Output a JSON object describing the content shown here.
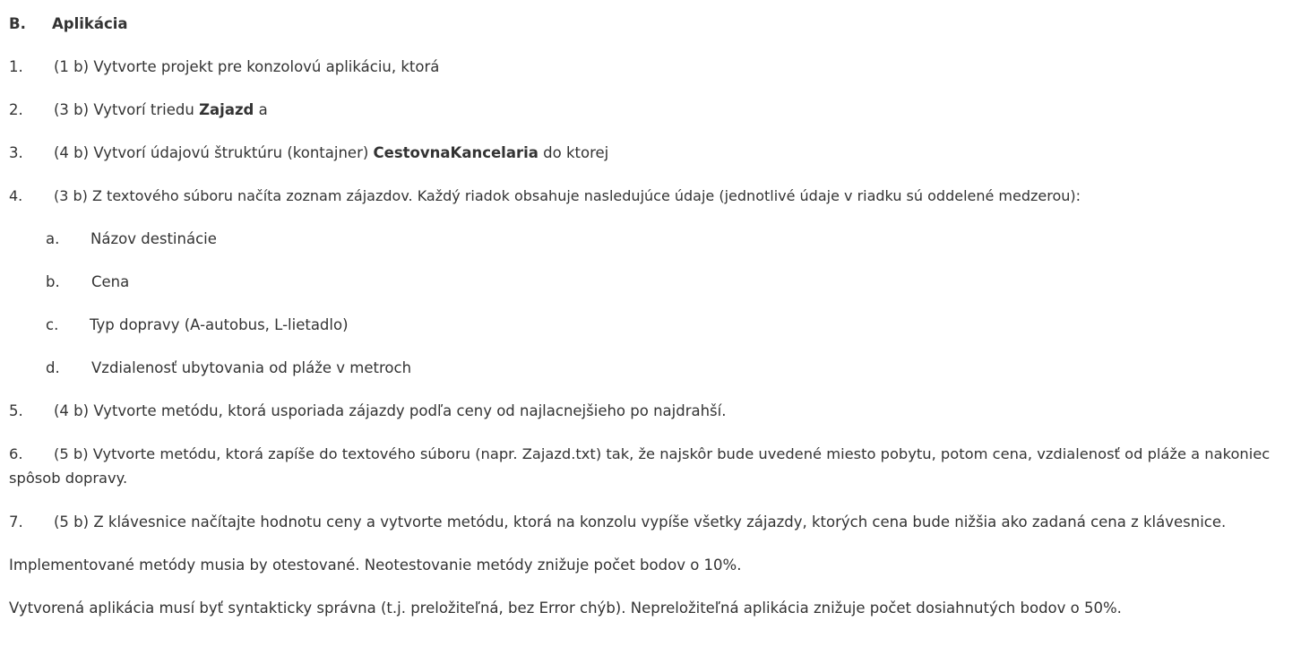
{
  "section": {
    "letter": "B.",
    "title": "Aplikácia"
  },
  "items": [
    {
      "num": "1.",
      "pre": "(1 b) Vytvorte projekt pre konzolovú aplikáciu, ktorá",
      "bold": "",
      "post": ""
    },
    {
      "num": "2.",
      "pre": "(3 b) Vytvorí triedu ",
      "bold": "Zajazd",
      "post": " a"
    },
    {
      "num": "3.",
      "pre": "(4 b) Vytvorí údajovú štruktúru (kontajner) ",
      "bold": "CestovnaKancelaria",
      "post": " do ktorej"
    },
    {
      "num": "4.",
      "pre": "(3 b) Z textového súboru načíta zoznam zájazdov. Každý riadok obsahuje nasledujúce údaje  (jednotlivé údaje v riadku sú oddelené medzerou):",
      "bold": "",
      "post": ""
    }
  ],
  "subitems": [
    {
      "letter": "a.",
      "text": "Názov destinácie"
    },
    {
      "letter": "b.",
      "text": "Cena"
    },
    {
      "letter": "c.",
      "text": "Typ dopravy (A-autobus, L-lietadlo)"
    },
    {
      "letter": "d.",
      "text": "Vzdialenosť ubytovania od pláže v metroch"
    }
  ],
  "items2": [
    {
      "num": "5.",
      "text": "(4 b) Vytvorte metódu, ktorá usporiada zájazdy podľa ceny od najlacnejšieho po najdrahší."
    },
    {
      "num": "6.",
      "text": "(5 b) Vytvorte metódu, ktorá zapíše do textového súboru (napr. Zajazd.txt) tak, že najskôr bude uvedené miesto pobytu, potom cena, vzdialenosť od pláže a nakoniec spôsob dopravy."
    },
    {
      "num": "7.",
      "text": "(5 b) Z klávesnice načítajte hodnotu ceny a vytvorte metódu, ktorá na konzolu vypíše všetky zájazdy, ktorých cena bude nižšia ako zadaná cena z klávesnice."
    }
  ],
  "notes": [
    "Implementované metódy musia by otestované. Neotestovanie metódy znižuje počet bodov o 10%.",
    "Vytvorená aplikácia musí byť syntakticky správna (t.j. preložiteľná, bez Error chýb). Nepreložiteľná aplikácia znižuje počet dosiahnutých bodov o 50%."
  ]
}
